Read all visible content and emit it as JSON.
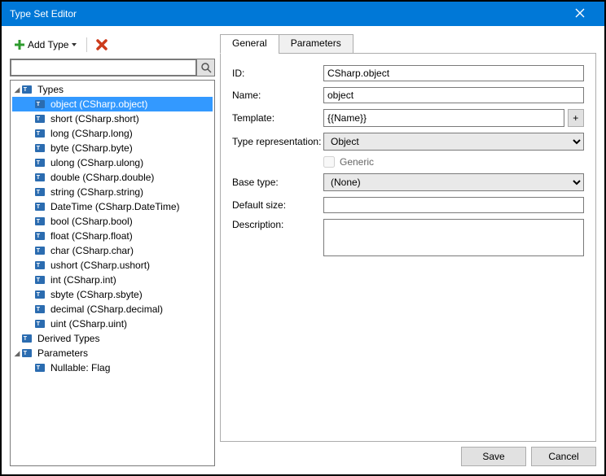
{
  "window": {
    "title": "Type Set Editor"
  },
  "toolbar": {
    "add_type": "Add Type"
  },
  "search": {
    "value": "",
    "placeholder": ""
  },
  "tree": {
    "root": "Types",
    "items": [
      {
        "label": "object (CSharp.object)",
        "selected": true
      },
      {
        "label": "short (CSharp.short)"
      },
      {
        "label": "long (CSharp.long)"
      },
      {
        "label": "byte (CSharp.byte)"
      },
      {
        "label": "ulong (CSharp.ulong)"
      },
      {
        "label": "double (CSharp.double)"
      },
      {
        "label": "string (CSharp.string)"
      },
      {
        "label": "DateTime (CSharp.DateTime)"
      },
      {
        "label": "bool (CSharp.bool)"
      },
      {
        "label": "float (CSharp.float)"
      },
      {
        "label": "char (CSharp.char)"
      },
      {
        "label": "ushort (CSharp.ushort)"
      },
      {
        "label": "int (CSharp.int)"
      },
      {
        "label": "sbyte (CSharp.sbyte)"
      },
      {
        "label": "decimal (CSharp.decimal)"
      },
      {
        "label": "uint (CSharp.uint)"
      }
    ],
    "derived": "Derived Types",
    "parameters": "Parameters",
    "param_items": [
      {
        "label": "Nullable: Flag"
      }
    ]
  },
  "tabs": {
    "general": "General",
    "parameters": "Parameters"
  },
  "form": {
    "id_label": "ID:",
    "id_value": "CSharp.object",
    "name_label": "Name:",
    "name_value": "object",
    "template_label": "Template:",
    "template_value": "{{Name}}",
    "repr_label": "Type representation:",
    "repr_value": "Object",
    "generic_label": "Generic",
    "base_label": "Base type:",
    "base_value": "(None)",
    "size_label": "Default size:",
    "size_value": "",
    "desc_label": "Description:",
    "desc_value": "",
    "plus": "+"
  },
  "footer": {
    "save": "Save",
    "cancel": "Cancel"
  }
}
